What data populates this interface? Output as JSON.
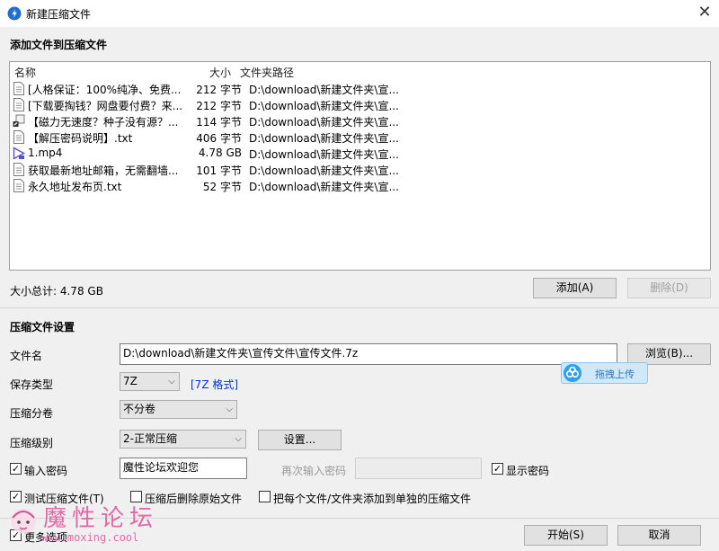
{
  "window": {
    "title": "新建压缩文件",
    "close_glyph": "✕"
  },
  "add_section": {
    "title": "添加文件到压缩文件",
    "columns": {
      "name": "名称",
      "size": "大小",
      "path": "文件夹路径"
    },
    "files": [
      {
        "icon": "text-file-icon",
        "name": "[人格保证：100%纯净、免费...",
        "size": "212 字节",
        "path": "D:\\download\\新建文件夹\\宣..."
      },
      {
        "icon": "text-file-icon",
        "name": "[下载要掏钱？网盘要付费？来...",
        "size": "212 字节",
        "path": "D:\\download\\新建文件夹\\宣..."
      },
      {
        "icon": "shortcut-file-icon",
        "name": "【磁力无速度？种子没有源？...",
        "size": "114 字节",
        "path": "D:\\download\\新建文件夹\\宣..."
      },
      {
        "icon": "text-file-icon",
        "name": "【解压密码说明】.txt",
        "size": "406 字节",
        "path": "D:\\download\\新建文件夹\\宣..."
      },
      {
        "icon": "video-file-icon",
        "name": "1.mp4",
        "size": "4.78 GB",
        "path": "D:\\download\\新建文件夹\\宣..."
      },
      {
        "icon": "text-file-icon",
        "name": "获取最新地址邮箱，无需翻墙...",
        "size": "101 字节",
        "path": "D:\\download\\新建文件夹\\宣..."
      },
      {
        "icon": "text-file-icon",
        "name": "永久地址发布页.txt",
        "size": "52 字节",
        "path": "D:\\download\\新建文件夹\\宣..."
      }
    ],
    "total_label": "大小总计: 4.78 GB",
    "add_button": "添加(A)",
    "delete_button": "删除(D)"
  },
  "settings": {
    "title": "压缩文件设置",
    "filename_label": "文件名",
    "filename_value": "D:\\download\\新建文件夹\\宣传文件\\宣传文件.7z",
    "browse_button": "浏览(B)...",
    "save_type_label": "保存类型",
    "save_type_value": "7Z",
    "format_link": "[7Z 格式]",
    "split_label": "压缩分卷",
    "split_value": "不分卷",
    "level_label": "压缩级别",
    "level_value": "2-正常压缩",
    "settings_button": "设置...",
    "password_checkbox_label": "输入密码",
    "password_value": "魔性论坛欢迎您",
    "reenter_label": "再次输入密码",
    "reenter_value": "",
    "show_password_label": "显示密码",
    "test_label": "测试压缩文件(T)",
    "delete_after_label": "压缩后删除原始文件",
    "separate_label": "把每个文件/文件夹添加到单独的压缩文件"
  },
  "footer": {
    "more_options": "更多选项",
    "start_button": "开始(S)",
    "cancel_button": "取消"
  },
  "overlay": {
    "upload_label": "拖拽上传"
  },
  "watermark": {
    "text": "魔性论坛",
    "url": "www.moxing.cool"
  },
  "states": {
    "password_checked": true,
    "show_password_checked": true,
    "test_checked": true,
    "delete_after_checked": false,
    "separate_checked": false,
    "more_options_checked": true
  },
  "colors": {
    "link": "#0033cc",
    "watermark": "#e26aa8",
    "upload_accent": "#2fa0e8"
  }
}
